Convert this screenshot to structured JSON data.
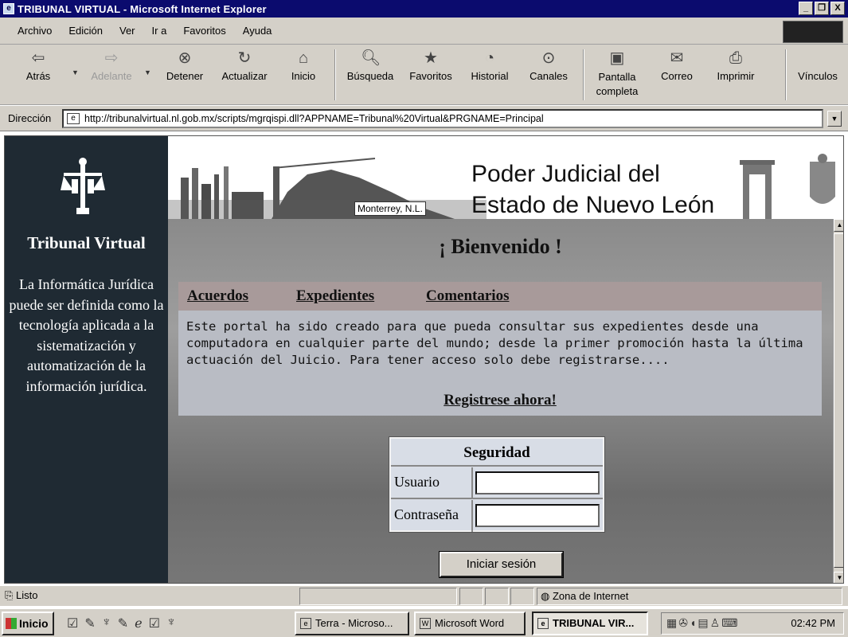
{
  "window": {
    "title": "TRIBUNAL VIRTUAL - Microsoft Internet Explorer",
    "controls": [
      "_",
      "❐",
      "X"
    ]
  },
  "menu": [
    "Archivo",
    "Edición",
    "Ver",
    "Ir a",
    "Favoritos",
    "Ayuda"
  ],
  "toolbar": {
    "back": "Atrás",
    "forward": "Adelante",
    "stop": "Detener",
    "refresh": "Actualizar",
    "home": "Inicio",
    "search": "Búsqueda",
    "favorites": "Favoritos",
    "history": "Historial",
    "channels": "Canales",
    "fullscreen_line1": "Pantalla",
    "fullscreen_line2": "completa",
    "mail": "Correo",
    "print": "Imprimir",
    "links": "Vínculos"
  },
  "address": {
    "label": "Dirección",
    "url": "http://tribunalvirtual.nl.gob.mx/scripts/mgrqispi.dll?APPNAME=Tribunal%20Virtual&PRGNAME=Principal"
  },
  "sidebar": {
    "title": "Tribunal Virtual",
    "text": "La Informática Jurídica puede ser definida como la tecnología aplicada a la sistematización y automatización de la información jurídica."
  },
  "header": {
    "photo_label": "Monterrey, N.L.",
    "title_line1": "Poder Judicial del",
    "title_line2": "Estado de Nuevo León"
  },
  "main": {
    "welcome": "¡ Bienvenido !",
    "tabs": [
      "Acuerdos",
      "Expedientes",
      "Comentarios"
    ],
    "intro": "Este portal ha sido creado para que pueda consultar sus expedientes desde una computadora en cualquier parte del mundo; desde la primer promoción hasta la última actuación del Juicio. Para tener acceso solo debe registrarse....",
    "register_link": "Registrese ahora!"
  },
  "login": {
    "header": "Seguridad",
    "user_label": "Usuario",
    "user_value": "",
    "password_label": "Contraseña",
    "password_value": "",
    "button": "Iniciar sesión"
  },
  "status": {
    "text": "Listo",
    "zone": "Zona de Internet"
  },
  "taskbar": {
    "start": "Inicio",
    "tasks": [
      "Terra - Microso...",
      "Microsoft Word",
      "TRIBUNAL VIR..."
    ],
    "clock": "02:42 PM"
  }
}
